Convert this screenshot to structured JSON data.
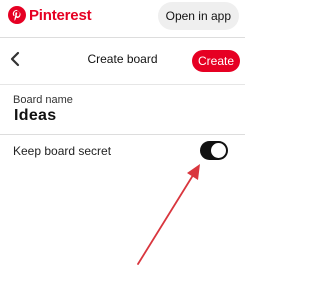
{
  "header": {
    "brand": "Pinterest",
    "open_in_app_label": "Open in app",
    "brand_color": "#e60023"
  },
  "toolbar": {
    "title": "Create board",
    "create_label": "Create",
    "back_icon": "chevron-left-icon"
  },
  "form": {
    "board_name_label": "Board name",
    "board_name_value": "Ideas",
    "secret_label": "Keep board secret",
    "secret_enabled": true
  },
  "annotation": {
    "arrow_color": "#d9363e"
  }
}
